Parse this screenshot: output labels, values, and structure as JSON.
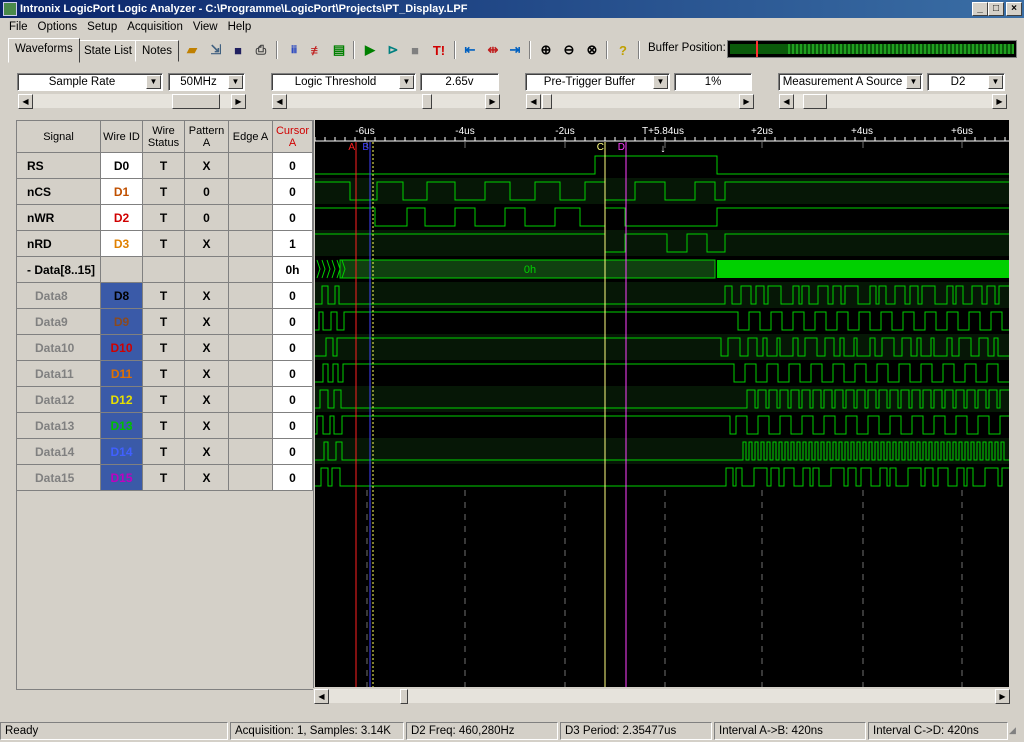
{
  "window": {
    "title": "Intronix LogicPort Logic Analyzer - C:\\Programme\\LogicPort\\Projects\\PT_Display.LPF"
  },
  "menu": [
    "File",
    "Options",
    "Setup",
    "Acquisition",
    "View",
    "Help"
  ],
  "tabs": [
    "Waveforms",
    "State List",
    "Notes"
  ],
  "toolbar": {
    "buffer_position_label": "Buffer Position:"
  },
  "controls": [
    {
      "name": "Sample Rate",
      "value": "50MHz"
    },
    {
      "name": "Logic Threshold",
      "value": "2.65v"
    },
    {
      "name": "Pre-Trigger Buffer",
      "value": "1%"
    },
    {
      "name": "Measurement A Source",
      "value": "D2"
    }
  ],
  "table": {
    "headers": {
      "signal": "Signal",
      "wire_id": "Wire ID",
      "wire_status": "Wire Status",
      "pattern": "Pattern A",
      "edge": "Edge A",
      "cursor": "Cursor A"
    },
    "rows": [
      {
        "name": "RS",
        "wire": "D0",
        "wire_color": "#000000",
        "status": "T",
        "pattern": "X",
        "cursor": "0",
        "sub": false
      },
      {
        "name": "nCS",
        "wire": "D1",
        "wire_color": "#c05000",
        "status": "T",
        "pattern": "0",
        "cursor": "0",
        "sub": false
      },
      {
        "name": "nWR",
        "wire": "D2",
        "wire_color": "#d00000",
        "status": "T",
        "pattern": "0",
        "cursor": "0",
        "sub": false
      },
      {
        "name": "nRD",
        "wire": "D3",
        "wire_color": "#e08000",
        "status": "T",
        "pattern": "X",
        "cursor": "1",
        "sub": false
      },
      {
        "name": "- Data[8..15]",
        "wire": "",
        "wire_color": "#000000",
        "status": "",
        "pattern": "",
        "cursor": "0h",
        "sub": false
      },
      {
        "name": "Data8",
        "wire": "D8",
        "wire_color": "#000000",
        "status": "T",
        "pattern": "X",
        "cursor": "0",
        "sub": true
      },
      {
        "name": "Data9",
        "wire": "D9",
        "wire_color": "#8a4a20",
        "status": "T",
        "pattern": "X",
        "cursor": "0",
        "sub": true
      },
      {
        "name": "Data10",
        "wire": "D10",
        "wire_color": "#d00000",
        "status": "T",
        "pattern": "X",
        "cursor": "0",
        "sub": true
      },
      {
        "name": "Data11",
        "wire": "D11",
        "wire_color": "#e07000",
        "status": "T",
        "pattern": "X",
        "cursor": "0",
        "sub": true
      },
      {
        "name": "Data12",
        "wire": "D12",
        "wire_color": "#e8e000",
        "status": "T",
        "pattern": "X",
        "cursor": "0",
        "sub": true
      },
      {
        "name": "Data13",
        "wire": "D13",
        "wire_color": "#00c000",
        "status": "T",
        "pattern": "X",
        "cursor": "0",
        "sub": true
      },
      {
        "name": "Data14",
        "wire": "D14",
        "wire_color": "#4060ff",
        "status": "T",
        "pattern": "X",
        "cursor": "0",
        "sub": true
      },
      {
        "name": "Data15",
        "wire": "D15",
        "wire_color": "#c000c0",
        "status": "T",
        "pattern": "X",
        "cursor": "0",
        "sub": true
      }
    ]
  },
  "timeline": {
    "ticks": [
      "-6us",
      "-4us",
      "-2us",
      "T+5.84us",
      "+2us",
      "+4us",
      "+6us"
    ],
    "cursors": [
      "A",
      "B",
      "C",
      "D"
    ],
    "bus_value": "0h"
  },
  "colors": {
    "trace": "#00d000",
    "trace_fill": "#0e3a0e",
    "cursor_a": "#ff2020",
    "cursor_b": "#4040ff",
    "cursor_c": "#ffff80",
    "cursor_d": "#ff40ff"
  },
  "statusbar": [
    "Ready",
    "Acquisition: 1, Samples: 3.14K",
    "D2 Freq: 460,280Hz",
    "D3 Period: 2.35477us",
    "Interval A->B: 420ns",
    "Interval C->D: 420ns"
  ]
}
